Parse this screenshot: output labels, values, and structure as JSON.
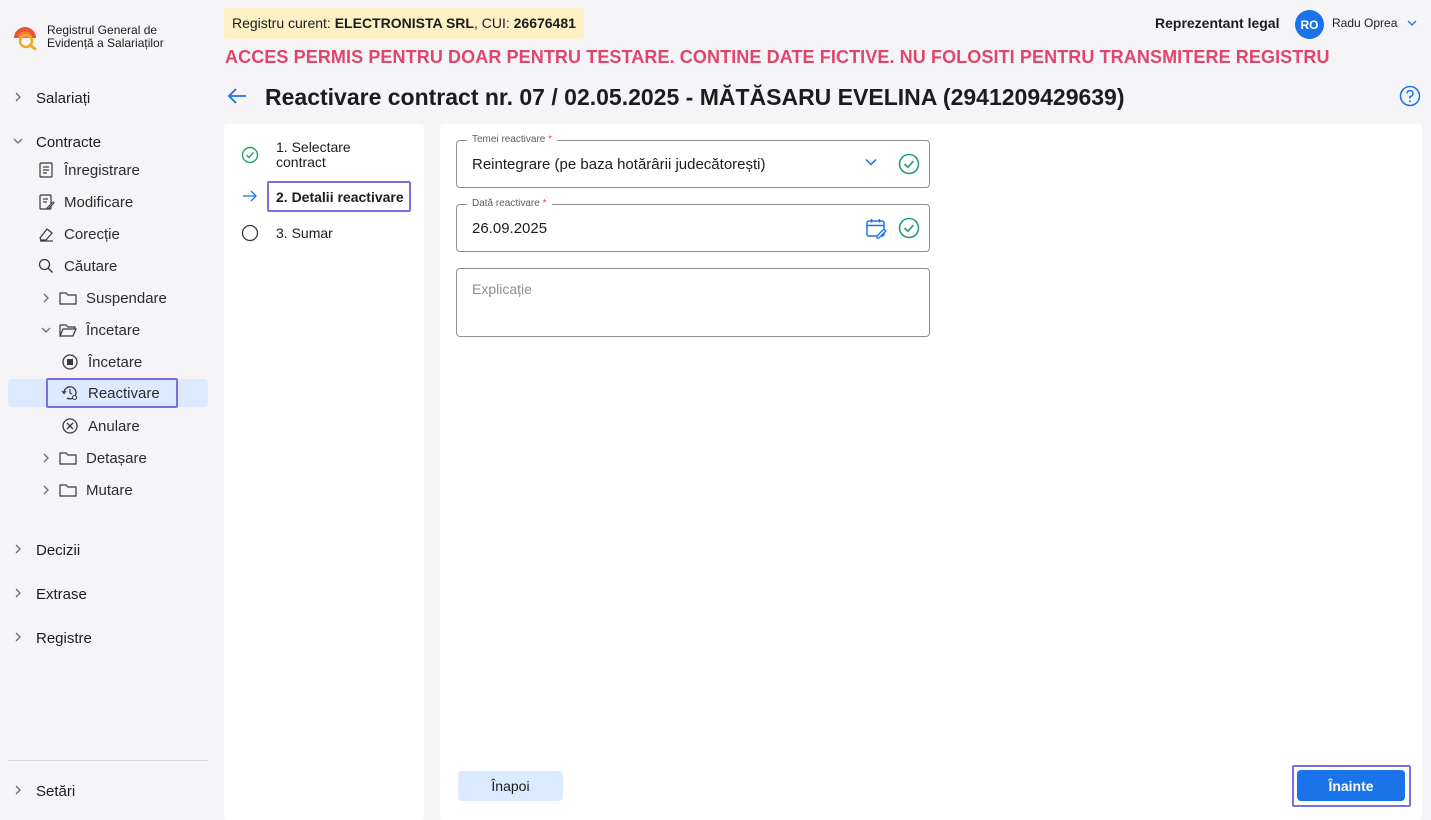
{
  "app": {
    "logo_line1": "Registrul General de",
    "logo_line2": "Evidență a Salariaților"
  },
  "sidebar": {
    "sections": {
      "salariati": "Salariați",
      "contracte": "Contracte",
      "decizii": "Decizii",
      "extrase": "Extrase",
      "registre": "Registre",
      "setari": "Setări"
    },
    "contract_items": {
      "inregistrare": "Înregistrare",
      "modificare": "Modificare",
      "corectie": "Corecție",
      "cautare": "Căutare",
      "suspendare": "Suspendare",
      "incetare_group": "Încetare",
      "incetare": "Încetare",
      "reactivare": "Reactivare",
      "anulare": "Anulare",
      "detasare": "Detașare",
      "mutare": "Mutare"
    }
  },
  "header": {
    "registry_prefix": "Registru curent: ",
    "company": "ELECTRONISTA SRL",
    "cui_prefix": ", CUI: ",
    "cui": "26676481",
    "warning": "ACCES PERMIS PENTRU DOAR PENTRU TESTARE. CONTINE DATE FICTIVE. NU FOLOSITI PENTRU TRANSMITERE REGISTRU",
    "role": "Reprezentant legal",
    "avatar_initials": "RO",
    "username": "Radu Oprea"
  },
  "page": {
    "title": "Reactivare contract nr. 07 / 02.05.2025 - MĂTĂSARU  EVELINA (2941209429639)"
  },
  "stepper": {
    "step1_line1": "1. Selectare",
    "step1_line2": "contract",
    "step2": "2. Detalii reactivare",
    "step3": "3. Sumar"
  },
  "form": {
    "temei_label": "Temei reactivare",
    "temei_value": "Reintegrare (pe baza hotărârii judecătorești)",
    "data_label": "Dată reactivare",
    "data_value": "26.09.2025",
    "explicatie_placeholder": "Explicație",
    "required_mark": "*"
  },
  "actions": {
    "back": "Înapoi",
    "next": "Înainte"
  },
  "colors": {
    "accent": "#1a73e8",
    "success": "#22a06b",
    "warning_text": "#e0466b",
    "highlight_box": "#7b6ee0"
  }
}
